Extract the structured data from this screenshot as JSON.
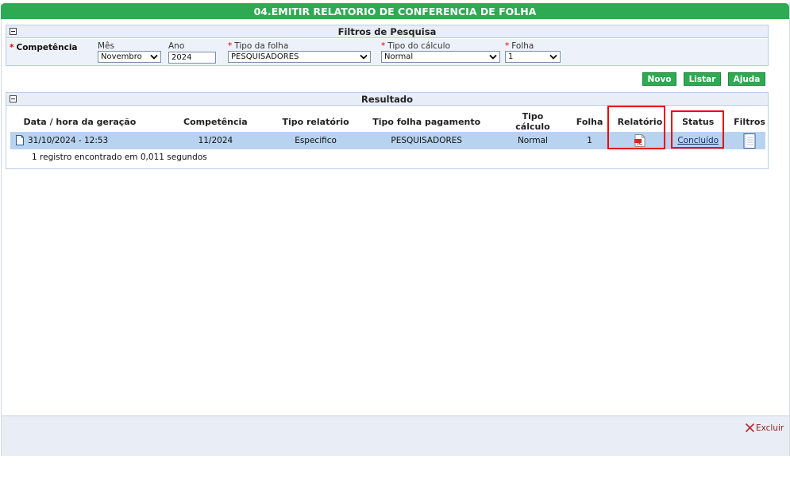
{
  "title": "04.EMITIR RELATORIO DE CONFERENCIA DE FOLHA",
  "filters": {
    "header": "Filtros de Pesquisa",
    "competencia_label": "Competência",
    "mes_label": "Mês",
    "mes_value": "Novembro",
    "ano_label": "Ano",
    "ano_value": "2024",
    "tipo_folha_label": "Tipo da folha",
    "tipo_folha_value": "PESQUISADORES",
    "tipo_calculo_label": "Tipo do cálculo",
    "tipo_calculo_value": "Normal",
    "folha_label": "Folha",
    "folha_value": "1",
    "required_mark": "*"
  },
  "buttons": {
    "novo": "Novo",
    "listar": "Listar",
    "ajuda": "Ajuda"
  },
  "results": {
    "header": "Resultado",
    "columns": [
      "Data / hora da geração",
      "Competência",
      "Tipo relatório",
      "Tipo folha pagamento",
      "Tipo cálculo",
      "Folha",
      "Relatório",
      "Status",
      "Filtros"
    ],
    "rows": [
      {
        "data_hora": "31/10/2024 - 12:53",
        "competencia": "11/2024",
        "tipo_relatorio": "Especifico",
        "tipo_folha": "PESQUISADORES",
        "tipo_calculo": "Normal",
        "folha": "1",
        "relatorio_icon": "pdf-icon",
        "status": "Concluído",
        "filtros_icon": "document-list-icon"
      }
    ],
    "summary": "1 registro encontrado em 0,011 segundos"
  },
  "footer": {
    "excluir_label": "Excluir",
    "excluir_icon": "x-icon"
  },
  "colors": {
    "title_bar": "#2eaa52",
    "row_selected": "#b7d3f0",
    "highlight": "#e8000a",
    "panel_head": "#e9eef6"
  }
}
